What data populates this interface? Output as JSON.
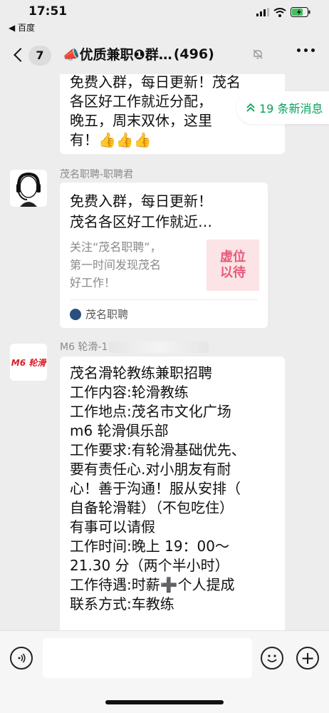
{
  "status": {
    "time": "17:51",
    "back_app": "◀ 百度"
  },
  "nav": {
    "unread_count": "7",
    "title": "📣优质兼职❶群…",
    "member_count": "(496)",
    "mute_icon": "bell-off-icon",
    "more_icon": "more-icon"
  },
  "new_messages": {
    "label": "19 条新消息",
    "color": "#07a15a"
  },
  "messages": [
    {
      "type": "text",
      "text": "免费入群，每日更新！茂名\n各区好工作就近分配，\n晚五，周末双休，这里\n有！👍👍👍"
    },
    {
      "type": "card",
      "sender": "茂名职聘-职聘君",
      "title": "免费入群，每日更新！\n茂名各区好工作就近…",
      "desc": "关注“茂名职聘”，\n第一时间发现茂名\n好工作！",
      "thumb_text": "虚位\n以待",
      "source": "茂名职聘"
    },
    {
      "type": "text",
      "sender": "M6 轮滑-1",
      "avatar_text": "M6 轮滑",
      "text": "茂名滑轮教练兼职招聘\n工作内容:轮滑教练\n工作地点:茂名市文化广场\nm6 轮滑俱乐部\n工作要求:有轮滑基础优先、\n要有责任心.对小朋友有耐\n心！善于沟通！服从安排（\n自备轮滑鞋）（不包吃住）\n有事可以请假\n工作时间:晚上 19：00～\n21.30 分（两个半小时）\n工作待遇:时薪➕个人提成\n联系方式:车教练"
    }
  ],
  "input": {
    "placeholder": ""
  },
  "colors": {
    "background": "#ededed",
    "bubble": "#ffffff",
    "accent_green": "#07a15a",
    "thumb_pink": "#e85a78"
  }
}
